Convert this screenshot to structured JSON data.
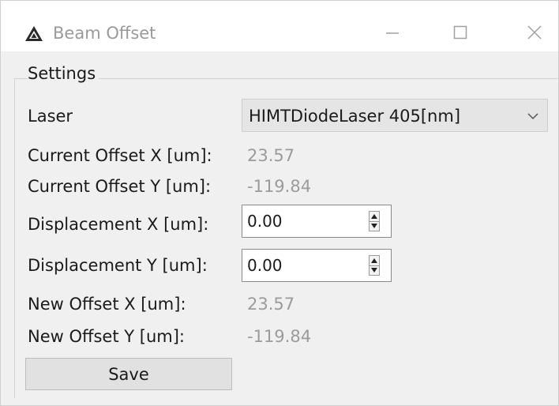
{
  "window": {
    "title": "Beam Offset",
    "icon": "warning-triangle-icon",
    "controls": [
      "minimize-icon",
      "maximize-icon",
      "close-icon"
    ]
  },
  "settings": {
    "group_title": "Settings",
    "laser_label": "Laser",
    "laser_selected": "HIMTDiodeLaser 405[nm]",
    "current_offset_x_label": "Current Offset X [um]:",
    "current_offset_x_value": "23.57",
    "current_offset_y_label": "Current Offset Y [um]:",
    "current_offset_y_value": "-119.84",
    "displacement_x_label": "Displacement X [um]:",
    "displacement_x_value": "0.00",
    "displacement_y_label": "Displacement Y [um]:",
    "displacement_y_value": "0.00",
    "new_offset_x_label": "New Offset X [um]:",
    "new_offset_x_value": "23.57",
    "new_offset_y_label": "New Offset Y [um]:",
    "new_offset_y_value": "-119.84",
    "save_label": "Save"
  },
  "colors": {
    "window_bg": "#f0f0f0",
    "titlebar_bg": "#ffffff",
    "readonly_text": "#9b9b9b",
    "button_bg": "#e1e1e1"
  }
}
